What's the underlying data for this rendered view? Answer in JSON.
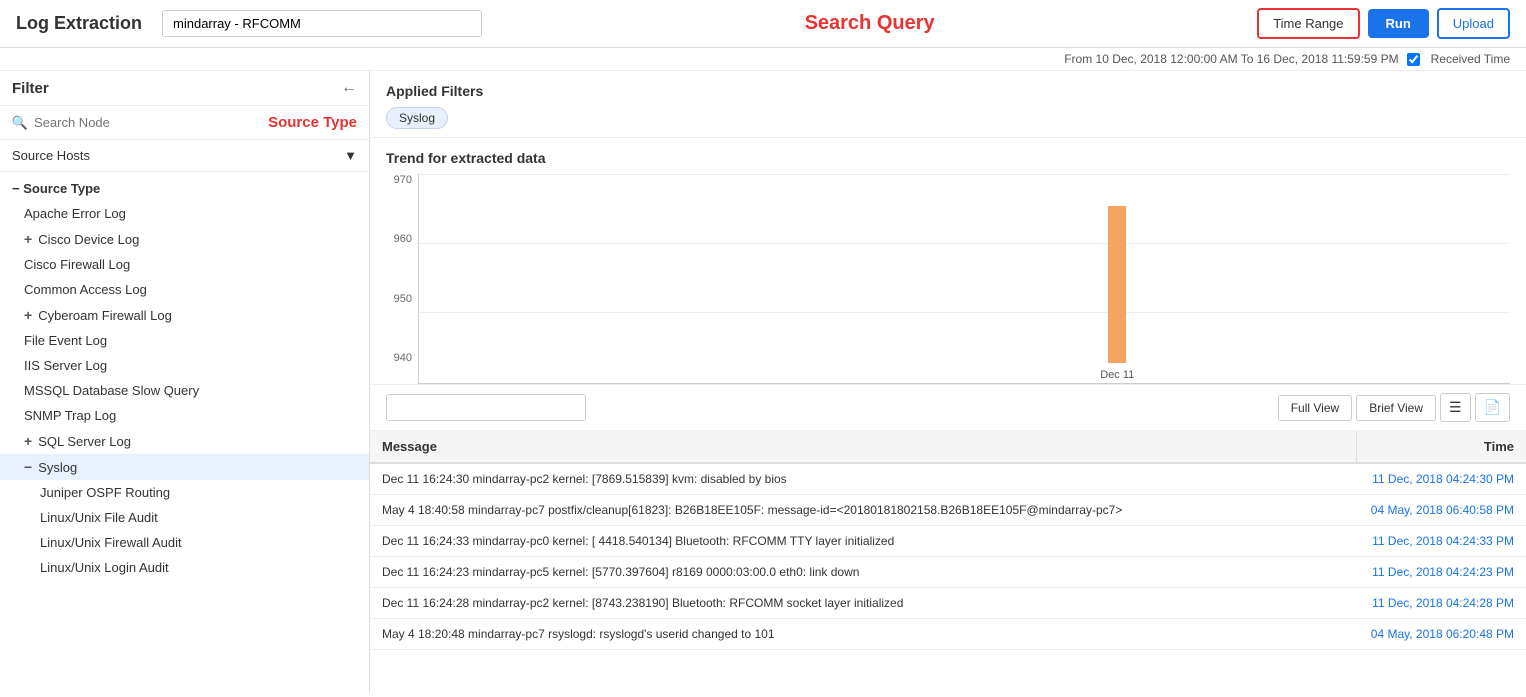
{
  "header": {
    "title": "Log Extraction",
    "search_query_label": "Search Query",
    "search_value": "mindarray - RFCOMM",
    "search_placeholder": "mindarray - RFCOMM",
    "btn_time_range": "Time Range",
    "btn_run": "Run",
    "btn_upload": "Upload"
  },
  "time_info": {
    "text": "From 10 Dec, 2018 12:00:00 AM To 16 Dec, 2018 11:59:59 PM",
    "checkbox_label": "Received Time",
    "checkbox_checked": true
  },
  "sidebar": {
    "filter_title": "Filter",
    "search_node_placeholder": "Search Node",
    "source_type_label": "Source Type",
    "source_hosts_label": "Source Hosts",
    "tree": [
      {
        "id": "source-type-header",
        "label": "- Source Type",
        "level": "header",
        "expanded": true
      },
      {
        "id": "apache-error-log",
        "label": "Apache Error Log",
        "level": "child"
      },
      {
        "id": "cisco-device-log",
        "label": "+ Cisco Device Log",
        "level": "child"
      },
      {
        "id": "cisco-firewall-log",
        "label": "Cisco Firewall Log",
        "level": "child"
      },
      {
        "id": "common-access-log",
        "label": "Common Access Log",
        "level": "child"
      },
      {
        "id": "cyberoam-firewall-log",
        "label": "+ Cyberoam Firewall Log",
        "level": "child"
      },
      {
        "id": "file-event-log",
        "label": "File Event Log",
        "level": "child"
      },
      {
        "id": "iis-server-log",
        "label": "IIS Server Log",
        "level": "child"
      },
      {
        "id": "mssql-database-slow",
        "label": "MSSQL Database Slow Query",
        "level": "child"
      },
      {
        "id": "snmp-trap-log",
        "label": "SNMP Trap Log",
        "level": "child"
      },
      {
        "id": "sql-server-log",
        "label": "+ SQL Server Log",
        "level": "child"
      },
      {
        "id": "syslog",
        "label": "- Syslog",
        "level": "child",
        "active": true
      },
      {
        "id": "juniper-ospf",
        "label": "Juniper OSPF Routing",
        "level": "grandchild"
      },
      {
        "id": "linux-unix-file-audit",
        "label": "Linux/Unix File Audit",
        "level": "grandchild"
      },
      {
        "id": "linux-unix-firewall-audit",
        "label": "Linux/Unix Firewall Audit",
        "level": "grandchild"
      },
      {
        "id": "linux-unix-login-audit",
        "label": "Linux/Unix Login Audit",
        "level": "grandchild"
      }
    ]
  },
  "main": {
    "applied_filters_title": "Applied Filters",
    "filter_badge": "Syslog",
    "chart_title": "Trend for extracted data",
    "chart_y_labels": [
      "970",
      "960",
      "950",
      "940"
    ],
    "chart_bar": {
      "x_pct": 64,
      "height_pct": 75,
      "label": "Dec 11"
    },
    "results_search_placeholder": "",
    "btn_full_view": "Full View",
    "btn_brief_view": "Brief View",
    "table_headers": [
      "Message",
      "Time"
    ],
    "table_rows": [
      {
        "message": "Dec 11 16:24:30 mindarray-pc2 kernel: [7869.515839] kvm: disabled by bios",
        "time": "11 Dec, 2018 04:24:30 PM"
      },
      {
        "message": "May 4 18:40:58 mindarray-pc7 postfix/cleanup[61823]: B26B18EE105F: message-id=<20180181802158.B26B18EE105F@mindarray-pc7>",
        "time": "04 May, 2018 06:40:58 PM"
      },
      {
        "message": "Dec 11 16:24:33 mindarray-pc0 kernel: [ 4418.540134] Bluetooth: RFCOMM TTY layer initialized",
        "time": "11 Dec, 2018 04:24:33 PM"
      },
      {
        "message": "Dec 11 16:24:23 mindarray-pc5 kernel: [5770.397604] r8169 0000:03:00.0 eth0: link down",
        "time": "11 Dec, 2018 04:24:23 PM"
      },
      {
        "message": "Dec 11 16:24:28 mindarray-pc2 kernel: [8743.238190] Bluetooth: RFCOMM socket layer initialized",
        "time": "11 Dec, 2018 04:24:28 PM"
      },
      {
        "message": "May 4 18:20:48 mindarray-pc7 rsyslogd: rsyslogd's userid changed to 101",
        "time": "04 May, 2018 06:20:48 PM"
      }
    ]
  }
}
